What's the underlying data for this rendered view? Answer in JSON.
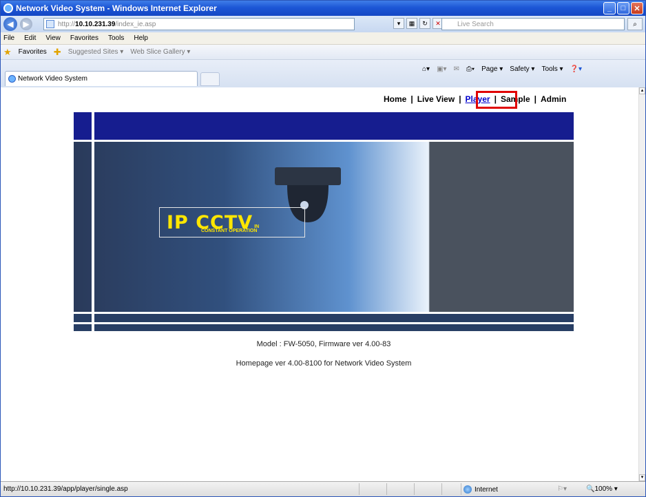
{
  "window": {
    "title": "Network Video System - Windows Internet Explorer"
  },
  "address": {
    "prefix": "http://",
    "host": "10.10.231.39",
    "path": "/index_ie.asp"
  },
  "search": {
    "placeholder": "Live Search"
  },
  "menu": [
    "File",
    "Edit",
    "View",
    "Favorites",
    "Tools",
    "Help"
  ],
  "favorites": {
    "label": "Favorites",
    "suggested": "Suggested Sites ▾",
    "webslice": "Web Slice Gallery ▾"
  },
  "tab": {
    "title": "Network Video System"
  },
  "commands": {
    "page": "Page ▾",
    "safety": "Safety ▾",
    "tools": "Tools ▾"
  },
  "nav": {
    "home": "Home",
    "live_view": "Live View",
    "player": "Player",
    "sample": "Sample",
    "admin": "Admin",
    "sep": "|"
  },
  "banner": {
    "logo_main": "IP CCTV",
    "logo_in": "IN",
    "logo_sub": "CONSTANT OPERATION"
  },
  "info": {
    "model": "Model : FW-5050, Firmware ver 4.00-83",
    "homepage": "Homepage ver 4.00-8100 for Network Video System"
  },
  "status": {
    "url": "http://10.10.231.39/app/player/single.asp",
    "zone": "Internet",
    "zoom": "100%"
  },
  "colors": {
    "highlight": "#e00000",
    "banner_blue": "#161d8f",
    "link": "#0000cc"
  }
}
